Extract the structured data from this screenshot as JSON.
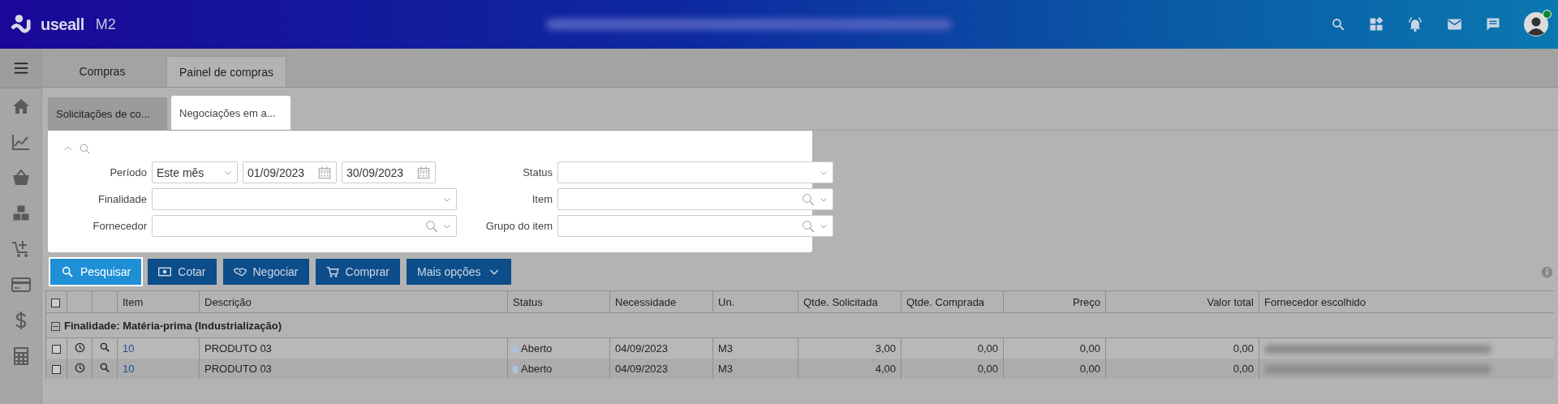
{
  "header": {
    "logo": "useall",
    "logo_suffix": "M2"
  },
  "user": {
    "online": true
  },
  "main_tabs": [
    {
      "label": "Compras",
      "selected": false
    },
    {
      "label": "Painel de compras",
      "selected": true
    }
  ],
  "sub_tabs": [
    {
      "label": "Solicitações de co...",
      "selected": false
    },
    {
      "label": "Negociações em a...",
      "selected": true
    }
  ],
  "filters": {
    "expanded": true,
    "period": {
      "label": "Período",
      "value": "Este mês",
      "date_from": "01/09/2023",
      "date_to": "30/09/2023"
    },
    "left": [
      {
        "label": "Finalidade",
        "kind": "select"
      },
      {
        "label": "Fornecedor",
        "kind": "lookup"
      }
    ],
    "right": [
      {
        "label": "Status",
        "kind": "select"
      },
      {
        "label": "Item",
        "kind": "lookup"
      },
      {
        "label": "Grupo do item",
        "kind": "lookup"
      }
    ]
  },
  "toolbar": [
    {
      "label": "Pesquisar",
      "kind": "search"
    },
    {
      "label": "Cotar",
      "kind": "cash"
    },
    {
      "label": "Negociar",
      "kind": "handshake"
    },
    {
      "label": "Comprar",
      "kind": "cart"
    },
    {
      "label": "Mais opções",
      "kind": "menu"
    }
  ],
  "table": {
    "header_checked": false,
    "columns": [
      {
        "label": "Item"
      },
      {
        "label": "Descrição"
      },
      {
        "label": "Status"
      },
      {
        "label": "Necessidade"
      },
      {
        "label": "Un."
      },
      {
        "label": "Qtde. Solicitada"
      },
      {
        "label": "Qtde. Comprada"
      },
      {
        "label": "Preço"
      },
      {
        "label": "Valor total"
      },
      {
        "label": "Fornecedor escolhido"
      }
    ],
    "groups": [
      {
        "label": "Finalidade: Matéria-prima (Industrialização)",
        "expanded": true,
        "rows": [
          {
            "checked": false,
            "item": "10",
            "description": "PRODUTO 03",
            "status": {
              "label": "Aberto",
              "color": "#a9c4e0"
            },
            "need_date": "04/09/2023",
            "unit": "M3",
            "qty_requested": "3,00",
            "qty_bought": "0,00",
            "price": "0,00",
            "total": "0,00"
          },
          {
            "checked": false,
            "item": "10",
            "description": "PRODUTO 03",
            "status": {
              "label": "Aberto",
              "color": "#a9c4e0"
            },
            "need_date": "04/09/2023",
            "unit": "M3",
            "qty_requested": "4,00",
            "qty_bought": "0,00",
            "price": "0,00",
            "total": "0,00"
          }
        ]
      }
    ]
  }
}
